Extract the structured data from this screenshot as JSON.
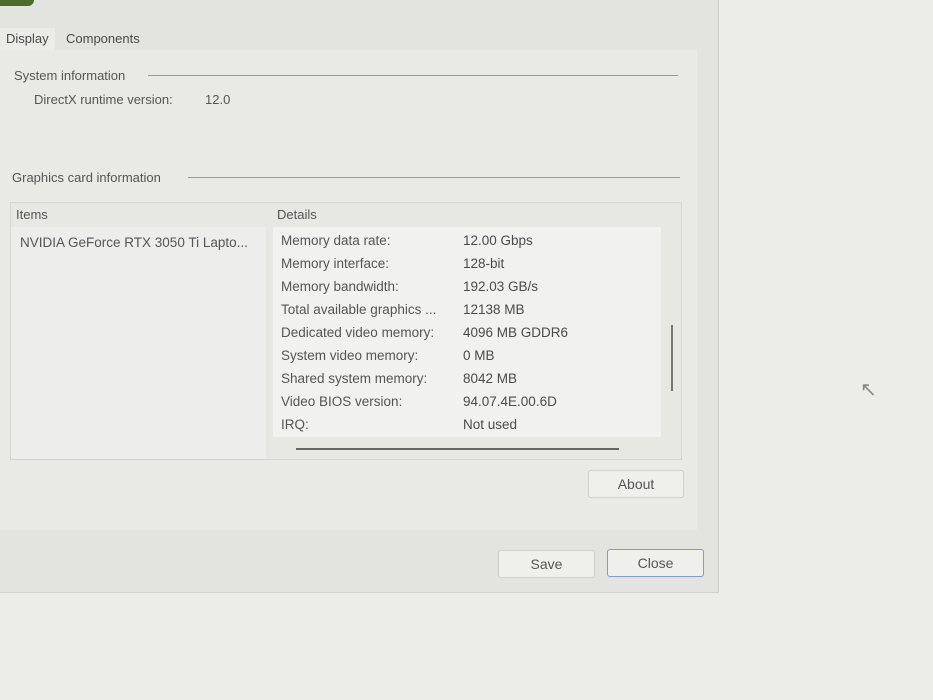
{
  "tabs": [
    {
      "label": "Display"
    },
    {
      "label": "Components"
    }
  ],
  "system_info": {
    "heading": "System information",
    "directx_label": "DirectX runtime version:",
    "directx_value": "12.0"
  },
  "graphics_info": {
    "heading": "Graphics card information",
    "columns": {
      "items": "Items",
      "details": "Details"
    },
    "item": "NVIDIA GeForce RTX 3050 Ti Lapto...",
    "details": [
      {
        "k": "Memory data rate:",
        "v": "12.00 Gbps"
      },
      {
        "k": "Memory interface:",
        "v": "128-bit"
      },
      {
        "k": "Memory bandwidth:",
        "v": "192.03 GB/s"
      },
      {
        "k": "Total available graphics ...",
        "v": "12138 MB"
      },
      {
        "k": "Dedicated video memory:",
        "v": "4096 MB GDDR6"
      },
      {
        "k": "System video memory:",
        "v": "0 MB"
      },
      {
        "k": "Shared system memory:",
        "v": "8042 MB"
      },
      {
        "k": "Video BIOS version:",
        "v": "94.07.4E.00.6D"
      },
      {
        "k": "IRQ:",
        "v": "Not used"
      }
    ]
  },
  "buttons": {
    "about": "About",
    "save": "Save",
    "close": "Close"
  }
}
